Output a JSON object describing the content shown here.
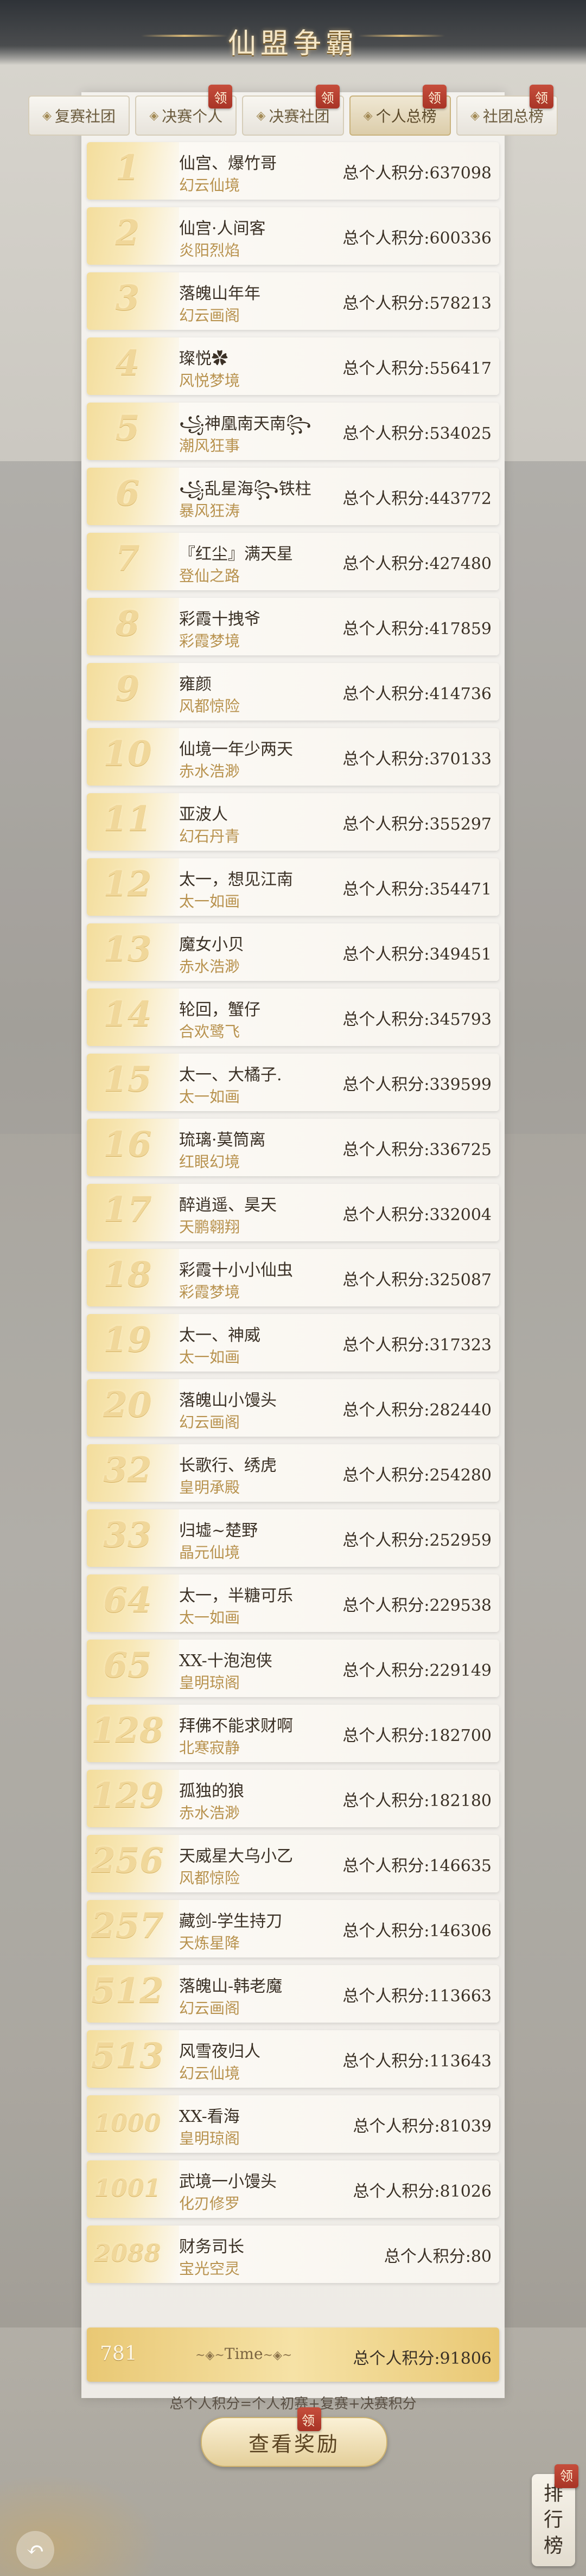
{
  "title": "仙盟争霸",
  "tabs": [
    {
      "label": "复赛社团",
      "active": false,
      "badge": ""
    },
    {
      "label": "决赛个人",
      "active": false,
      "badge": "领"
    },
    {
      "label": "决赛社团",
      "active": false,
      "badge": "领"
    },
    {
      "label": "个人总榜",
      "active": true,
      "badge": "领"
    },
    {
      "label": "社团总榜",
      "active": false,
      "badge": "领"
    }
  ],
  "score_label": "总个人积分",
  "rows": [
    {
      "rank": "1",
      "name": "仙宫、爆竹哥",
      "server": "幻云仙境",
      "score": "总个人积分:637098"
    },
    {
      "rank": "2",
      "name": "仙宫·人间客",
      "server": "炎阳烈焰",
      "score": "总个人积分:600336"
    },
    {
      "rank": "3",
      "name": "落魄山年年",
      "server": "幻云画阁",
      "score": "总个人积分:578213"
    },
    {
      "rank": "4",
      "name": "璨悦✿",
      "server": "风悦梦境",
      "score": "总个人积分:556417"
    },
    {
      "rank": "5",
      "name": "꧁神凰南天南꧂",
      "server": "潮风狂事",
      "score": "总个人积分:534025"
    },
    {
      "rank": "6",
      "name": "꧁乱星海꧂铁柱",
      "server": "暴风狂涛",
      "score": "总个人积分:443772"
    },
    {
      "rank": "7",
      "name": "『红尘』满天星",
      "server": "登仙之路",
      "score": "总个人积分:427480"
    },
    {
      "rank": "8",
      "name": "彩霞十拽爷",
      "server": "彩霞梦境",
      "score": "总个人积分:417859"
    },
    {
      "rank": "9",
      "name": "雍颜",
      "server": "风都惊险",
      "score": "总个人积分:414736"
    },
    {
      "rank": "10",
      "name": "仙境一年少两天",
      "server": "赤水浩渺",
      "score": "总个人积分:370133"
    },
    {
      "rank": "11",
      "name": "亚波人",
      "server": "幻石丹青",
      "score": "总个人积分:355297"
    },
    {
      "rank": "12",
      "name": "太一，想见江南",
      "server": "太一如画",
      "score": "总个人积分:354471"
    },
    {
      "rank": "13",
      "name": "魔女小贝",
      "server": "赤水浩渺",
      "score": "总个人积分:349451"
    },
    {
      "rank": "14",
      "name": "轮回，蟹仔",
      "server": "合欢鹭飞",
      "score": "总个人积分:345793"
    },
    {
      "rank": "15",
      "name": "太一、大橘子.",
      "server": "太一如画",
      "score": "总个人积分:339599"
    },
    {
      "rank": "16",
      "name": "琉璃·莫筒离",
      "server": "红眼幻境",
      "score": "总个人积分:336725"
    },
    {
      "rank": "17",
      "name": "醉逍遥、昊天",
      "server": "天鹏翱翔",
      "score": "总个人积分:332004"
    },
    {
      "rank": "18",
      "name": "彩霞十小小仙虫",
      "server": "彩霞梦境",
      "score": "总个人积分:325087"
    },
    {
      "rank": "19",
      "name": "太一、神威",
      "server": "太一如画",
      "score": "总个人积分:317323"
    },
    {
      "rank": "20",
      "name": "落魄山小馒头",
      "server": "幻云画阁",
      "score": "总个人积分:282440"
    },
    {
      "rank": "32",
      "name": "长歌行、绣虎",
      "server": "皇明承殿",
      "score": "总个人积分:254280"
    },
    {
      "rank": "33",
      "name": "归墟~楚野",
      "server": "晶元仙境",
      "score": "总个人积分:252959"
    },
    {
      "rank": "64",
      "name": "太一，半糖可乐",
      "server": "太一如画",
      "score": "总个人积分:229538"
    },
    {
      "rank": "65",
      "name": "XX-十泡泡侠",
      "server": "皇明琼阁",
      "score": "总个人积分:229149"
    },
    {
      "rank": "128",
      "name": "拜佛不能求财啊",
      "server": "北寒寂静",
      "score": "总个人积分:182700"
    },
    {
      "rank": "129",
      "name": "孤独的狼",
      "server": "赤水浩渺",
      "score": "总个人积分:182180"
    },
    {
      "rank": "256",
      "name": "天威星大乌小乙",
      "server": "风都惊险",
      "score": "总个人积分:146635"
    },
    {
      "rank": "257",
      "name": "藏剑-学生持刀",
      "server": "天炼星降",
      "score": "总个人积分:146306"
    },
    {
      "rank": "512",
      "name": "落魄山-韩老魔",
      "server": "幻云画阁",
      "score": "总个人积分:113663"
    },
    {
      "rank": "513",
      "name": "风雪夜归人",
      "server": "幻云仙境",
      "score": "总个人积分:113643"
    },
    {
      "rank": "1000",
      "name": "XX-看海",
      "server": "皇明琼阁",
      "score": "总个人积分:81039"
    },
    {
      "rank": "1001",
      "name": "武境一小馒头",
      "server": "化刃修罗",
      "score": "总个人积分:81026"
    },
    {
      "rank": "2088",
      "name": "财务司长",
      "server": "宝光空灵",
      "score": "总个人积分:80"
    }
  ],
  "self": {
    "rank": "781",
    "name": "Time",
    "score": "总个人积分:91806"
  },
  "formula": "总个人积分=个人初赛+复赛+决赛积分",
  "reward_button": "查看奖励",
  "reward_badge": "领",
  "rank_fab": {
    "line1": "排",
    "line2": "行",
    "line3": "榜",
    "badge": "领"
  },
  "back_icon": "↶"
}
